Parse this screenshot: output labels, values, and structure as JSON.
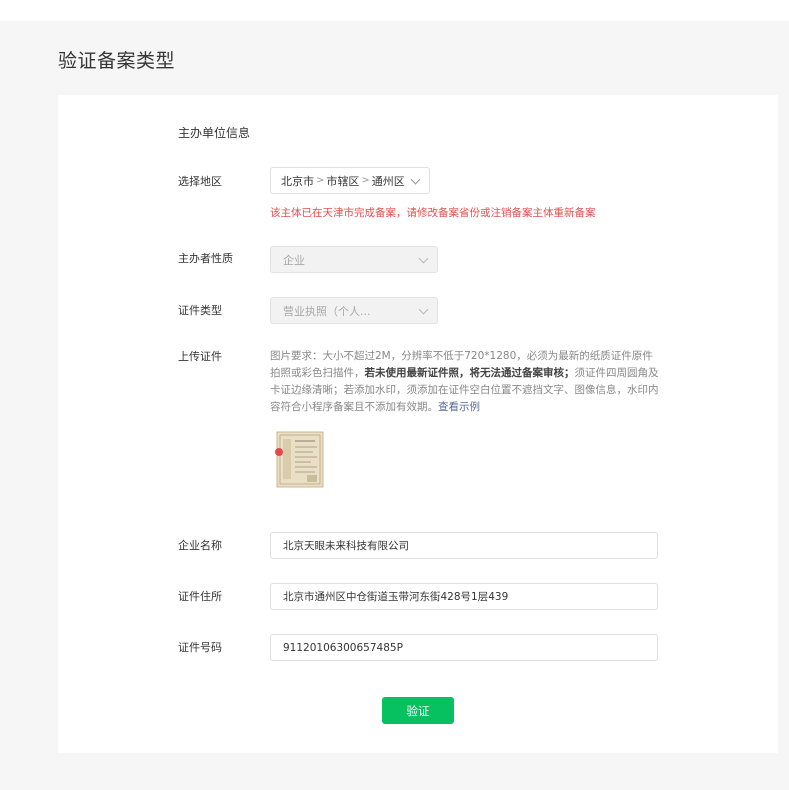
{
  "page": {
    "title": "验证备案类型"
  },
  "form": {
    "section_title": "主办单位信息",
    "region": {
      "label": "选择地区",
      "province": "北京市",
      "city": "市辖区",
      "district": "通州区",
      "separator": ">",
      "error": "该主体已在天津市完成备案，请修改备案省份或注销备案主体重新备案"
    },
    "org_type": {
      "label": "主办者性质",
      "value": "企业"
    },
    "cert_type": {
      "label": "证件类型",
      "value": "营业执照（个人..."
    },
    "upload": {
      "label": "上传证件",
      "desc_part1": "图片要求：大小不超过2M，分辨率不低于720*1280，必须为最新的纸质证件原件拍照或彩色扫描件，",
      "desc_bold": "若未使用最新证件照，将无法通过备案审核；",
      "desc_part2": "须证件四周圆角及卡证边缘清晰；若添加水印，须添加在证件空白位置不遮挡文字、图像信息，水印内容符合小程序备案且不添加有效期。",
      "link": "查看示例"
    },
    "company_name": {
      "label": "企业名称",
      "value": "北京天眼未来科技有限公司"
    },
    "address": {
      "label": "证件住所",
      "value": "北京市通州区中仓街道玉带河东街428号1层439"
    },
    "cert_number": {
      "label": "证件号码",
      "value": "91120106300657485P"
    },
    "submit_label": "验证"
  },
  "colors": {
    "primary": "#07c160",
    "error": "#e25050",
    "link": "#576b95",
    "background": "#f6f6f6"
  }
}
